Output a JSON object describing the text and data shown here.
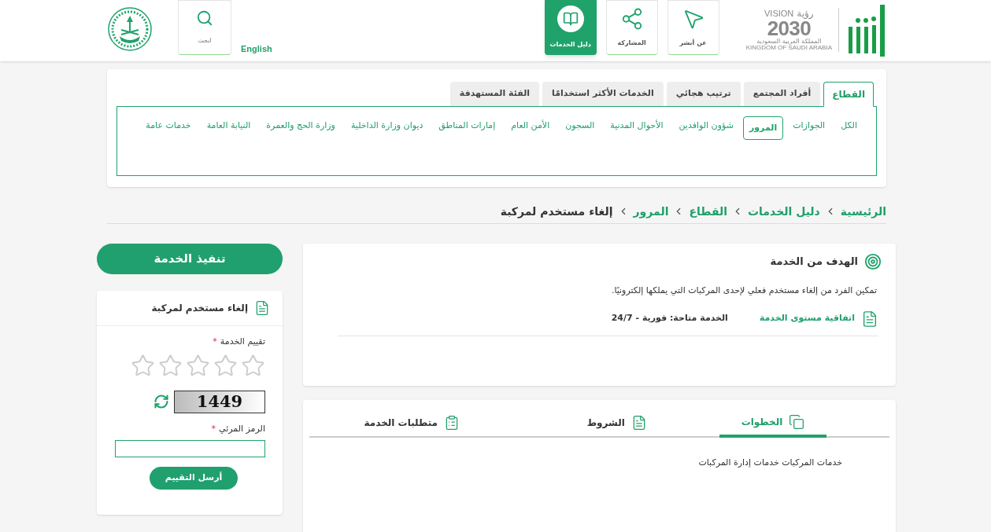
{
  "header": {
    "logo_text": {
      "vision_ar": "رؤية",
      "vision_en": "VISION",
      "year": "2030",
      "kingdom_ar": "المملكة العربية السعودية",
      "kingdom_en": "KINGDOM OF SAUDI ARABIA"
    },
    "nav": [
      {
        "label": "عن أبشر",
        "kind": "cursor",
        "selected": false
      },
      {
        "label": "المشاركة",
        "kind": "share",
        "selected": false
      },
      {
        "label": "دليل الخدمات",
        "kind": "book",
        "selected": true
      }
    ],
    "language": "English",
    "search": {
      "label": "ابحث"
    }
  },
  "filter": {
    "tabs": [
      {
        "label": "القطاع",
        "selected": true
      },
      {
        "label": "أفراد المجتمع",
        "selected": false
      },
      {
        "label": "ترتيب هجائي",
        "selected": false
      },
      {
        "label": "الخدمات الأكثر استخدامًا",
        "selected": false
      },
      {
        "label": "الفئة المستهدفة",
        "selected": false
      }
    ],
    "chips": [
      {
        "label": "الكل",
        "selected": false
      },
      {
        "label": "الجوازات",
        "selected": false
      },
      {
        "label": "المرور",
        "selected": true
      },
      {
        "label": "شؤون الوافدين",
        "selected": false
      },
      {
        "label": "الأحوال المدنية",
        "selected": false
      },
      {
        "label": "السجون",
        "selected": false
      },
      {
        "label": "الأمن العام",
        "selected": false
      },
      {
        "label": "إمارات المناطق",
        "selected": false
      },
      {
        "label": "ديوان وزارة الداخلية",
        "selected": false
      },
      {
        "label": "وزارة الحج والعمرة",
        "selected": false
      },
      {
        "label": "النيابة العامة",
        "selected": false
      },
      {
        "label": "خدمات عامة",
        "selected": false
      }
    ]
  },
  "breadcrumb": [
    "الرئيسية",
    "دليل الخدمات",
    "القطاع",
    "المرور",
    "إلغاء مستخدم لمركبة"
  ],
  "goal": {
    "title": "الهدف من الخدمة",
    "description": "تمكين الفرد من إلغاء مستخدم فعلي لإحدى المركبات التي يملكها إلكترونيًا.",
    "sla": "اتفاقية مستوى الخدمة",
    "availability": "الخدمة متاحة: فورية - 24/7"
  },
  "details": {
    "tabs": [
      {
        "label": "الخطوات",
        "kind": "steps",
        "selected": true
      },
      {
        "label": "الشروط",
        "kind": "terms",
        "selected": false
      },
      {
        "label": "متطلبات الخدمة",
        "kind": "requirements",
        "selected": false
      }
    ],
    "content": "خدمات المركبات خدمات إدارة المركبات"
  },
  "execute_button": "تنفيذ الخدمة",
  "rating": {
    "title": "إلغاء مستخدم لمركبة",
    "rating_label": "تقييم الخدمة",
    "required_mark": "*",
    "stars": 0,
    "captcha": "1449",
    "code_label": "الرمز المرئي",
    "code_required_mark": "*",
    "submit": "أرسل التقييم"
  }
}
